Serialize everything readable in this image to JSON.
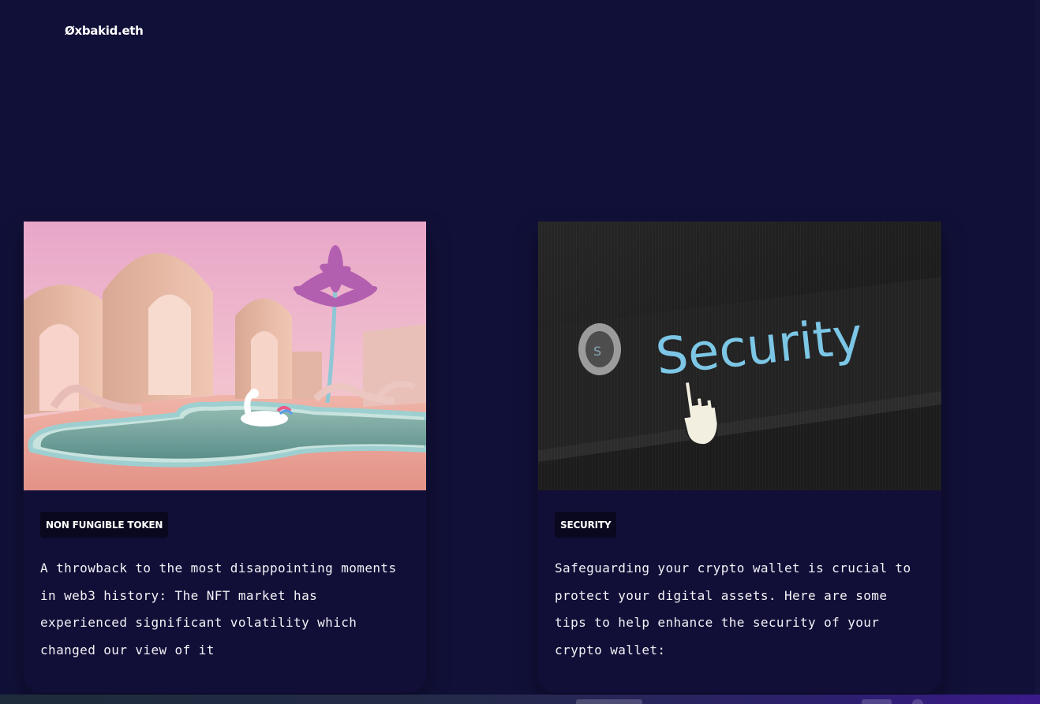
{
  "header": {
    "logo": "Øxbakid.eth"
  },
  "posts": [
    {
      "image_subject": "pink-arches-pool-unicorn",
      "tag": "NON FUNGIBLE TOKEN",
      "excerpt": "A throwback to the most disappointing moments in web3 history: The NFT market has experienced significant volatility which changed our view of it"
    },
    {
      "image_subject": "security-screen-cursor",
      "image_text": "Security",
      "tag": "SECURITY",
      "excerpt": "Safeguarding your crypto wallet is crucial to protect your digital assets. Here are some tips to help enhance the security of your crypto wallet:"
    }
  ],
  "colors": {
    "background": "#111038",
    "card": "#110f37",
    "tag_bg": "#09081f",
    "text": "#ffffff"
  }
}
